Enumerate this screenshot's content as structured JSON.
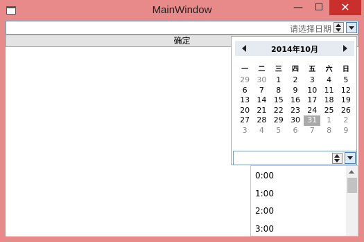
{
  "window": {
    "title": "MainWindow",
    "minimize": "—",
    "maximize": "☐",
    "close": "✕"
  },
  "date_picker": {
    "placeholder": "请选择日期"
  },
  "confirm_button": {
    "label": "确定"
  },
  "calendar": {
    "month_label": "2014年10月",
    "weekdays": [
      "一",
      "二",
      "三",
      "四",
      "五",
      "六",
      "日"
    ],
    "days": [
      {
        "d": "29",
        "other": true
      },
      {
        "d": "30",
        "other": true
      },
      {
        "d": "1"
      },
      {
        "d": "2"
      },
      {
        "d": "3"
      },
      {
        "d": "4"
      },
      {
        "d": "5"
      },
      {
        "d": "6"
      },
      {
        "d": "7"
      },
      {
        "d": "8"
      },
      {
        "d": "9"
      },
      {
        "d": "10"
      },
      {
        "d": "11"
      },
      {
        "d": "12"
      },
      {
        "d": "13"
      },
      {
        "d": "14"
      },
      {
        "d": "15"
      },
      {
        "d": "16"
      },
      {
        "d": "17"
      },
      {
        "d": "18"
      },
      {
        "d": "19"
      },
      {
        "d": "20"
      },
      {
        "d": "21"
      },
      {
        "d": "22"
      },
      {
        "d": "23"
      },
      {
        "d": "24"
      },
      {
        "d": "25"
      },
      {
        "d": "26"
      },
      {
        "d": "27"
      },
      {
        "d": "28"
      },
      {
        "d": "29"
      },
      {
        "d": "30"
      },
      {
        "d": "31",
        "selected": true
      },
      {
        "d": "1",
        "other": true
      },
      {
        "d": "2",
        "other": true
      },
      {
        "d": "3",
        "other": true
      },
      {
        "d": "4",
        "other": true
      },
      {
        "d": "5",
        "other": true
      },
      {
        "d": "6",
        "other": true
      },
      {
        "d": "7",
        "other": true
      },
      {
        "d": "8",
        "other": true
      },
      {
        "d": "9",
        "other": true
      }
    ]
  },
  "time_picker": {
    "value": "",
    "options": [
      "0:00",
      "1:00",
      "2:00",
      "3:00"
    ]
  },
  "colors": {
    "window_frame": "#e8898a",
    "close_button": "#c9302c",
    "accent_border": "#7a9ac0"
  }
}
